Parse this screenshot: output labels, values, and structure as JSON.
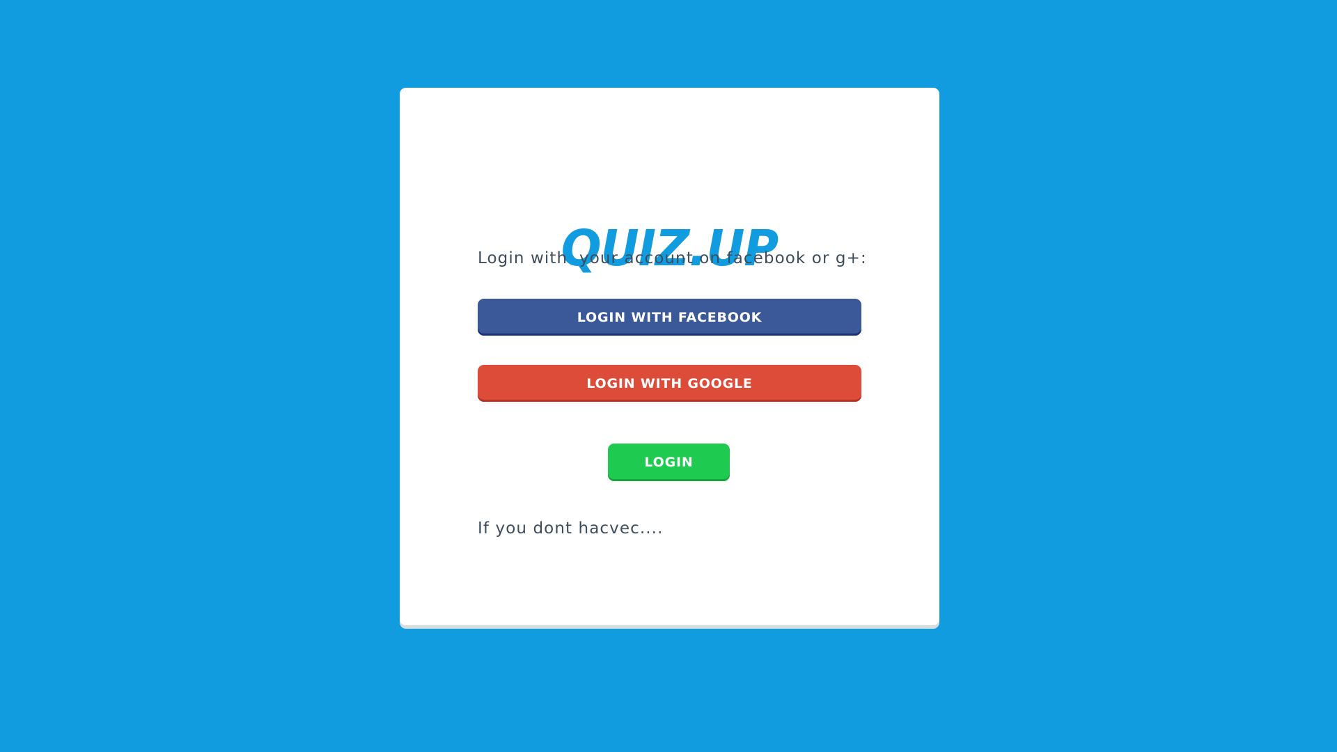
{
  "app": {
    "logo_text": "QUIZ.UP"
  },
  "login": {
    "intro_text": "Login with  your account on facebook or g+:",
    "facebook_label": "LOGIN WITH FACEBOOK",
    "google_label": "LOGIN WITH GOOGLE",
    "login_label": "LOGIN",
    "footer_text": "If you dont hacvec...."
  },
  "colors": {
    "background": "#109cdf",
    "card": "#ffffff",
    "facebook": "#3b5998",
    "google": "#dd4b39",
    "login": "#1ecb50",
    "text": "#3e4d5b"
  }
}
